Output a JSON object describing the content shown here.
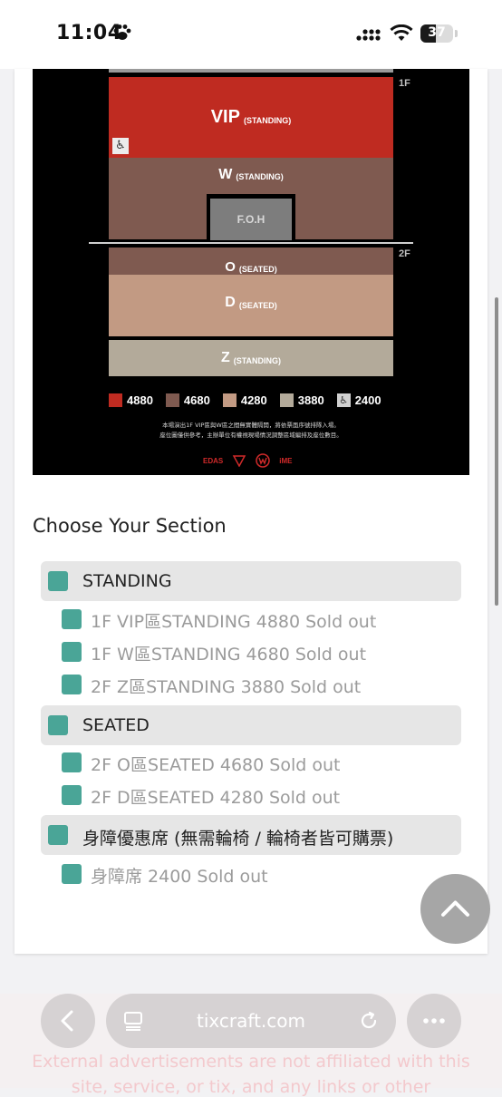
{
  "status_bar": {
    "time": "11:04",
    "battery": "37"
  },
  "seat_map": {
    "floors": [
      "1F",
      "2F"
    ],
    "zones": [
      {
        "name": "VIP",
        "type": "(STANDING)",
        "color": "#bf2b21"
      },
      {
        "name": "W",
        "type": "(STANDING)",
        "color": "#7f5a50"
      },
      {
        "name": "F.O.H",
        "type": "",
        "color": "#7d7d7d"
      },
      {
        "name": "O",
        "type": "(SEATED)",
        "color": "#7f5a50"
      },
      {
        "name": "D",
        "type": "(SEATED)",
        "color": "#c29a83"
      },
      {
        "name": "Z",
        "type": "(STANDING)",
        "color": "#b3aa9a"
      }
    ],
    "legend": [
      {
        "price": "4880",
        "color": "#bf2b21"
      },
      {
        "price": "4680",
        "color": "#7f5a50"
      },
      {
        "price": "4280",
        "color": "#c29a83"
      },
      {
        "price": "3880",
        "color": "#b3aa9a"
      },
      {
        "price": "2400",
        "color": "#d0d0d0",
        "icon": "wheelchair-icon"
      }
    ],
    "note_line1": "本場演出1F VIP區與W區之間無實體隔開，將依票面序號排隊入場。",
    "note_line2": "座位圖僅供參考，主辦單位有權視現場情況調整區域編排及座位數目。",
    "logos": [
      "EDAS",
      "iME"
    ]
  },
  "section_heading": "Choose Your Section",
  "categories": [
    {
      "label": "STANDING",
      "items": [
        "1F VIP區STANDING 4880 Sold out",
        "1F W區STANDING 4680 Sold out",
        "2F Z區STANDING 3880 Sold out"
      ]
    },
    {
      "label": "SEATED",
      "items": [
        "2F O區SEATED 4680 Sold out",
        "2F D區SEATED 4280 Sold out"
      ]
    },
    {
      "label": "身障優惠席 (無需輪椅 / 輪椅者皆可購票)",
      "items": [
        "身障席 2400 Sold out"
      ]
    }
  ],
  "browser": {
    "url": "tixcraft.com",
    "ad_line1": "External advertisements are not affiliated with this",
    "ad_line2": "site, service, or tix, and any links or other"
  },
  "colors": {
    "checkbox": "#4aa597",
    "accent_red": "#bf2b21"
  }
}
